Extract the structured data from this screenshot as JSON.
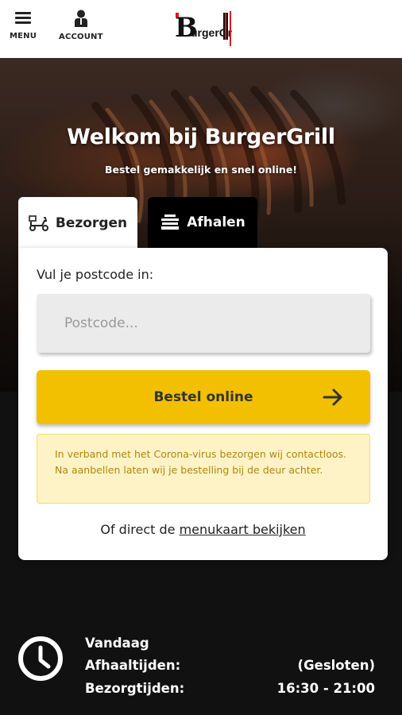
{
  "header": {
    "menu_label": "MENU",
    "account_label": "ACCOUNT",
    "logo_text": "BurgerGrill"
  },
  "hero": {
    "title": "Welkom bij BurgerGrill",
    "subtitle": "Bestel gemakkelijk en snel online!"
  },
  "tabs": [
    {
      "label": "Bezorgen",
      "icon": "scooter-icon",
      "active": true
    },
    {
      "label": "Afhalen",
      "icon": "takeaway-bag-icon",
      "active": false
    }
  ],
  "form": {
    "label": "Vul je postcode in:",
    "placeholder": "Postcode...",
    "value": "",
    "order_button": "Bestel online"
  },
  "notice": {
    "line1": "In verband met het Corona-virus bezorgen wij contactloos.",
    "line2": "Na aanbellen laten wij je bestelling bij de deur achter."
  },
  "direct": {
    "prefix": "Of direct de",
    "link": "menukaart bekijken"
  },
  "hours": {
    "day": "Vandaag",
    "rows": [
      {
        "label": "Afhaaltijden:",
        "value": "(Gesloten)"
      },
      {
        "label": "Bezorgtijden:",
        "value": "16:30 - 21:00"
      }
    ]
  },
  "colors": {
    "accent": "#f2c000",
    "notice_bg": "#fdf3c6",
    "notice_text": "#b4860c",
    "logo_red": "#d71920"
  }
}
